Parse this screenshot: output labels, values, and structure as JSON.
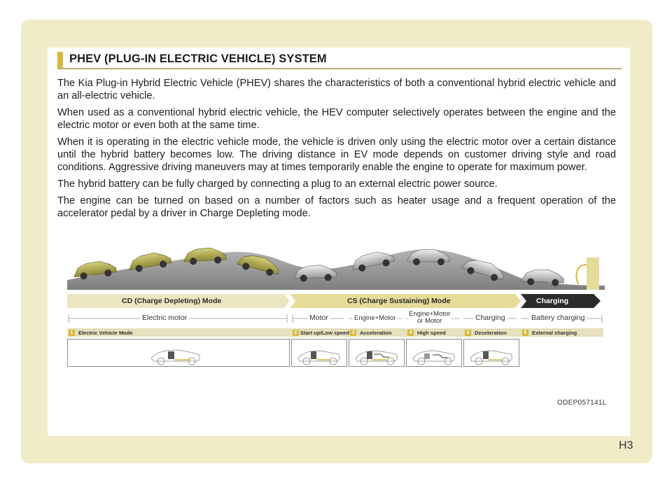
{
  "section": {
    "title": "PHEV (PLUG-IN ELECTRIC VEHICLE) SYSTEM"
  },
  "paragraphs": [
    "The Kia Plug-in Hybrid Electric Vehicle (PHEV) shares the characteristics of both a conventional hybrid electric vehicle and an all-electric vehicle.",
    "When used as a conventional hybrid electric vehicle, the HEV computer selectively operates between the engine and the electric motor or even both at the same time.",
    "When it is operating in the electric vehicle mode, the vehicle is driven only using the electric motor over a certain distance until the hybrid battery becomes low. The driving distance in EV mode depends on customer driving style and road conditions. Aggressive driving maneuvers may at times temporarily enable the engine to operate for maximum power.",
    "The hybrid battery can be fully charged by connecting a plug to an external electric power source.",
    "The engine can be turned on based on a number of factors such as  heater usage and a frequent operation of the accelerator pedal by a driver in Charge Depleting mode."
  ],
  "figure": {
    "modes": {
      "cd": "CD (Charge Depleting) Mode",
      "cs": "CS (Charge Sustaining) Mode",
      "charging": "Charging"
    },
    "sources": {
      "electric_motor": "Electric motor",
      "motor": "Motor",
      "engine_motor": "Engine+Motor",
      "engine_or_motor_line1": "Engine+Motor",
      "engine_or_motor_line2": "or Motor",
      "charging": "Charging",
      "battery_charging": "Battery charging"
    },
    "phases": [
      {
        "num": "1",
        "label": "Electric Vehicle Mode"
      },
      {
        "num": "2",
        "label": "Start up/Low speed"
      },
      {
        "num": "3",
        "label": "Acceleration"
      },
      {
        "num": "4",
        "label": "High speed"
      },
      {
        "num": "5",
        "label": "Deceleration"
      },
      {
        "num": "6",
        "label": "External charging"
      }
    ],
    "code": "ODEP057141L"
  },
  "page_number": "H3",
  "colors": {
    "frame": "#f0ecc8",
    "accent": "#d8b840",
    "cs_band": "#e6dc9a",
    "charging_band": "#2b2b2b",
    "road": "#8d8d8d"
  }
}
